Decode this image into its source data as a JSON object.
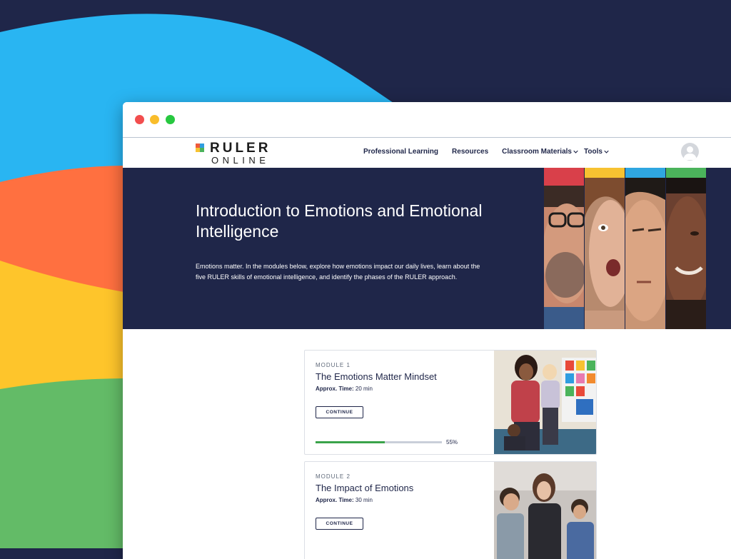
{
  "colors": {
    "background_navy": "#1f2649",
    "wave_blue": "#29b5f2",
    "wave_orange": "#ff7040",
    "wave_yellow": "#fec52b",
    "wave_green": "#63bb67",
    "progress_green": "#3aa34a"
  },
  "browser": {
    "window_controls": [
      "close",
      "minimize",
      "maximize"
    ]
  },
  "site": {
    "logo_word_1": "RULER",
    "logo_word_2": "ONLINE",
    "nav": {
      "professional_learning": "Professional Learning",
      "resources": "Resources",
      "classroom_materials": "Classroom Materials",
      "tools": "Tools"
    },
    "avatar_icon": "user-avatar-icon"
  },
  "hero": {
    "title": "Introduction to Emotions and Emotional Intelligence",
    "description": "Emotions matter. In the modules below, explore how emotions impact our daily lives, learn about the five RULER skills of emotional intelligence, and identify the phases of the RULER approach."
  },
  "modules": [
    {
      "label": "MODULE 1",
      "title": "The Emotions Matter Mindset",
      "time_label": "Approx. Time:",
      "time_value": "20 min",
      "button": "CONTINUE",
      "progress": 55,
      "progress_text": "55%"
    },
    {
      "label": "MODULE 2",
      "title": "The Impact of Emotions",
      "time_label": "Approx. Time:",
      "time_value": "30 min",
      "button": "CONTINUE"
    }
  ]
}
